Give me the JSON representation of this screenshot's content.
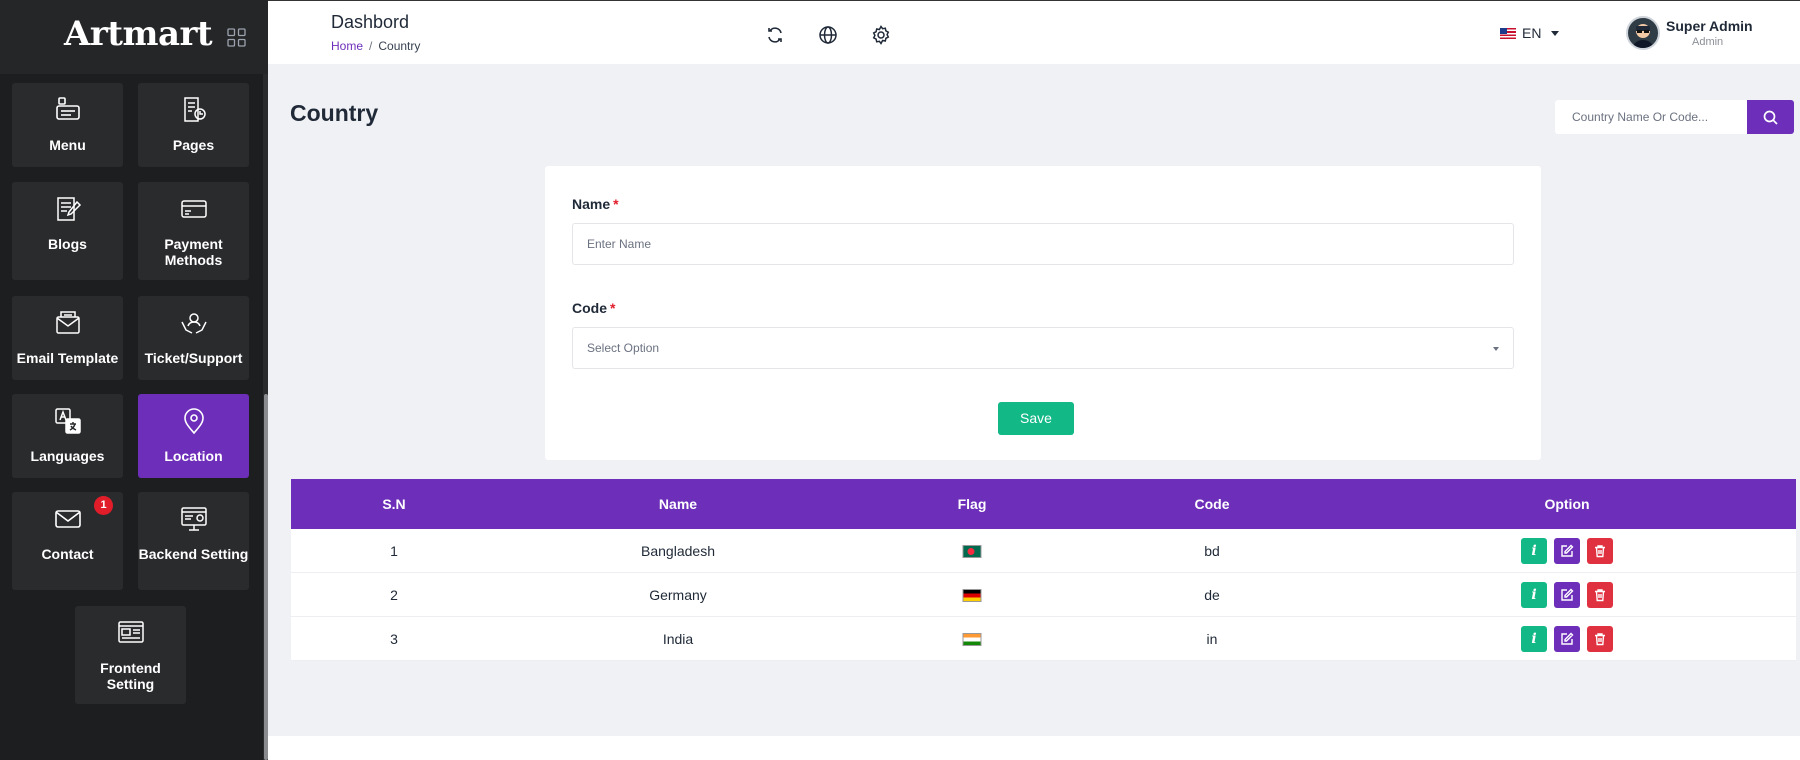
{
  "brand": {
    "name": "Artmart"
  },
  "sidebar": {
    "items": [
      {
        "label": "Menu",
        "icon": "menu-icon"
      },
      {
        "label": "Pages",
        "icon": "pages-icon"
      },
      {
        "label": "Blogs",
        "icon": "blogs-icon"
      },
      {
        "label": "Payment Methods",
        "icon": "payment-card-icon"
      },
      {
        "label": "Email Template",
        "icon": "email-template-icon"
      },
      {
        "label": "Ticket/Support",
        "icon": "support-icon"
      },
      {
        "label": "Languages",
        "icon": "translate-icon"
      },
      {
        "label": "Location",
        "icon": "location-pin-icon",
        "active": true
      },
      {
        "label": "Contact",
        "icon": "envelope-icon",
        "badge": "1"
      },
      {
        "label": "Backend Setting",
        "icon": "backend-setting-icon"
      },
      {
        "label": "Frontend Setting",
        "icon": "frontend-setting-icon"
      }
    ]
  },
  "header": {
    "title": "Dashbord",
    "breadcrumb": {
      "home": "Home",
      "separator": "/",
      "current": "Country"
    },
    "language": "EN",
    "user": {
      "name": "Super Admin",
      "role": "Admin"
    }
  },
  "main": {
    "title": "Country",
    "search": {
      "placeholder": "Country Name Or Code..."
    }
  },
  "form": {
    "name_label": "Name",
    "name_placeholder": "Enter Name",
    "code_label": "Code",
    "code_placeholder": "Select Option",
    "required_mark": "*",
    "save_label": "Save"
  },
  "table": {
    "headers": [
      "S.N",
      "Name",
      "Flag",
      "Code",
      "Option"
    ],
    "rows": [
      {
        "sn": "1",
        "name": "Bangladesh",
        "flag": "bd",
        "code": "bd"
      },
      {
        "sn": "2",
        "name": "Germany",
        "flag": "de",
        "code": "de"
      },
      {
        "sn": "3",
        "name": "India",
        "flag": "in",
        "code": "in"
      }
    ],
    "action_info_label": "i"
  },
  "colors": {
    "primary": "#6d2fb9",
    "success": "#12b886",
    "danger": "#e03140",
    "sidebar_bg": "#1d1e20",
    "tile_bg": "#2a2b2d",
    "page_bg": "#f0f1f5"
  }
}
